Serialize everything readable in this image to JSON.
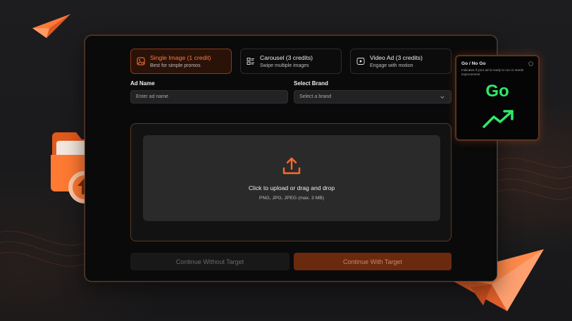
{
  "tabs": [
    {
      "label": "Single Image (1 credit)",
      "sub": "Best for simple promos",
      "icon": "image-icon",
      "active": true
    },
    {
      "label": "Carousel (3 credits)",
      "sub": "Swipe multiple images",
      "icon": "carousel-icon",
      "active": false
    },
    {
      "label": "Video Ad (3 credits)",
      "sub": "Engage with motion",
      "icon": "video-icon",
      "active": false
    }
  ],
  "ad_name": {
    "label": "Ad Name",
    "placeholder": "Enter ad name"
  },
  "brand": {
    "label": "Select Brand",
    "placeholder": "Select a brand"
  },
  "upload": {
    "title": "Click to upload or drag and drop",
    "formats": "PNG, JPG, JPEG (max. 3 MB)",
    "icon": "upload-icon"
  },
  "buttons": {
    "without_target": "Continue Without Target",
    "with_target": "Continue With Target"
  },
  "go_no_go": {
    "title": "Go / No Go",
    "description": "Indicates if your ad is ready to run or needs improvement",
    "verdict": "Go",
    "icon": "trend-up-icon"
  },
  "colors": {
    "accent": "#ff6a2a",
    "go_green": "#2ee86a",
    "panel_bg": "#0a0a0a",
    "page_bg": "#1b1b1d"
  }
}
